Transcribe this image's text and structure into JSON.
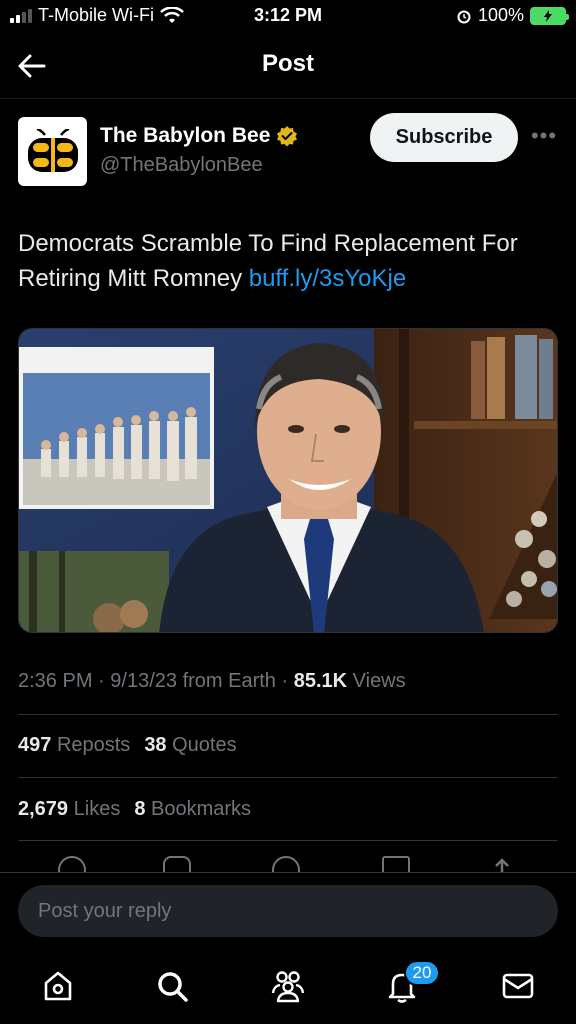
{
  "status_bar": {
    "carrier": "T-Mobile Wi-Fi",
    "time": "3:12 PM",
    "battery": "100%"
  },
  "header": {
    "title": "Post"
  },
  "author": {
    "name": "The Babylon Bee",
    "handle": "@TheBabylonBee",
    "subscribe_label": "Subscribe"
  },
  "post": {
    "text": "Democrats Scramble To Find Replacement For Retiring Mitt Romney ",
    "link": "buff.ly/3sYoKje"
  },
  "meta": {
    "time": "2:36 PM",
    "date": "9/13/23",
    "source": "from Earth",
    "views_count": "85.1K",
    "views_label": "Views"
  },
  "stats": {
    "reposts_count": "497",
    "reposts_label": "Reposts",
    "quotes_count": "38",
    "quotes_label": "Quotes",
    "likes_count": "2,679",
    "likes_label": "Likes",
    "bookmarks_count": "8",
    "bookmarks_label": "Bookmarks"
  },
  "reply": {
    "placeholder": "Post your reply"
  },
  "tabbar": {
    "notifications_badge": "20"
  },
  "colors": {
    "accent": "#1d9bf0",
    "verified_badge": "#e2b719",
    "background": "#000000"
  }
}
